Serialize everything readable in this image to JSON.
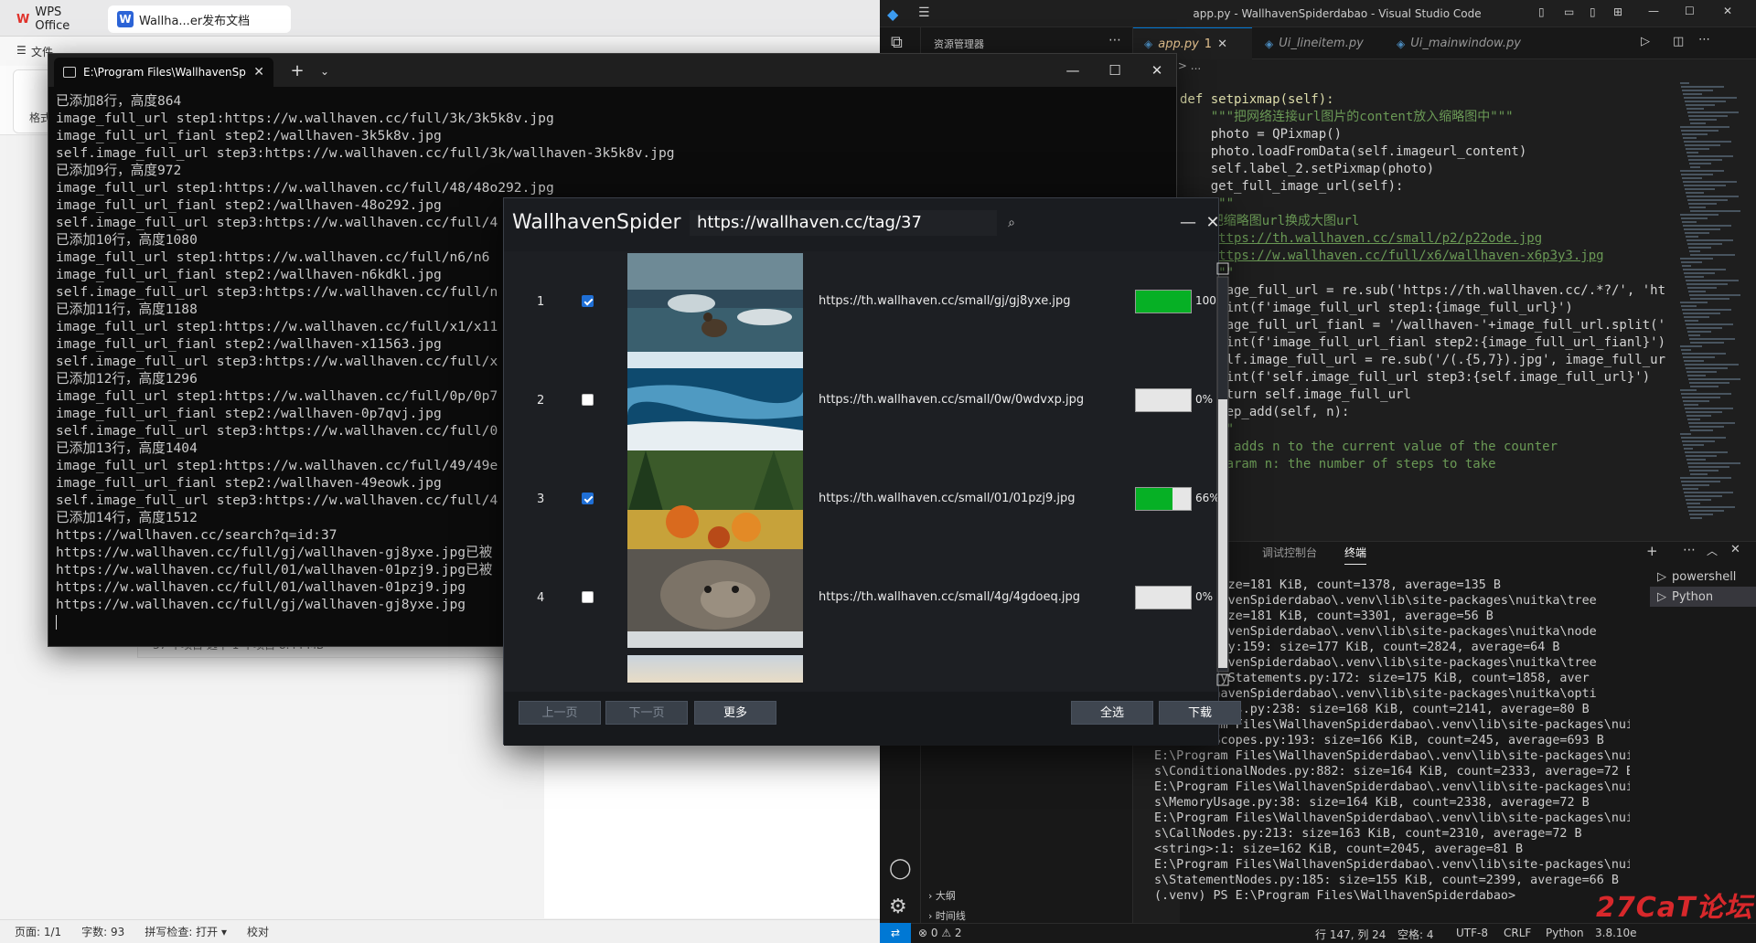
{
  "wps": {
    "tab_office": "WPS Office",
    "tab_doc": "Wallha...er发布文档",
    "menu_file": "文件",
    "format_label": "格式",
    "explorer_status": "37 个项目    选中 1 个项目  8.44 MB",
    "status": [
      "页面: 1/1",
      "字数: 93",
      "拼写检查: 打开 ▾",
      "校对"
    ]
  },
  "terminal": {
    "tab_title": "E:\\Program Files\\WallhavenSp",
    "new_tab": "+",
    "dropdown": "⌄",
    "minimize": "—",
    "maximize": "☐",
    "close": "✕",
    "lines": [
      "已添加8行，高度864",
      "image_full_url step1:https://w.wallhaven.cc/full/3k/3k5k8v.jpg",
      "image_full_url_fianl step2:/wallhaven-3k5k8v.jpg",
      "self.image_full_url step3:https://w.wallhaven.cc/full/3k/wallhaven-3k5k8v.jpg",
      "已添加9行，高度972",
      "image_full_url step1:https://w.wallhaven.cc/full/48/48o292.jpg",
      "image_full_url_fianl step2:/wallhaven-48o292.jpg",
      "self.image_full_url step3:https://w.wallhaven.cc/full/4",
      "已添加10行，高度1080",
      "image_full_url step1:https://w.wallhaven.cc/full/n6/n6",
      "image_full_url_fianl step2:/wallhaven-n6kdkl.jpg",
      "self.image_full_url step3:https://w.wallhaven.cc/full/n",
      "已添加11行，高度1188",
      "image_full_url step1:https://w.wallhaven.cc/full/x1/x11",
      "image_full_url_fianl step2:/wallhaven-x11563.jpg",
      "self.image_full_url step3:https://w.wallhaven.cc/full/x",
      "已添加12行，高度1296",
      "image_full_url step1:https://w.wallhaven.cc/full/0p/0p7",
      "image_full_url_fianl step2:/wallhaven-0p7qvj.jpg",
      "self.image_full_url step3:https://w.wallhaven.cc/full/0",
      "已添加13行，高度1404",
      "image_full_url step1:https://w.wallhaven.cc/full/49/49e",
      "image_full_url_fianl step2:/wallhaven-49eowk.jpg",
      "self.image_full_url step3:https://w.wallhaven.cc/full/4",
      "已添加14行，高度1512",
      "https://wallhaven.cc/search?q=id:37",
      "https://w.wallhaven.cc/full/gj/wallhaven-gj8yxe.jpg已被",
      "https://w.wallhaven.cc/full/01/wallhaven-01pzj9.jpg已被",
      "https://w.wallhaven.cc/full/01/wallhaven-01pzj9.jpg",
      "https://w.wallhaven.cc/full/gj/wallhaven-gj8yxe.jpg"
    ]
  },
  "vscode": {
    "title": "app.py - WallhavenSpiderdabao - Visual Studio Code",
    "explorer_label": "资源管理器",
    "tabs": [
      {
        "label": "app.py",
        "badge": "1"
      },
      {
        "label": "Ui_lineitem.py"
      },
      {
        "label": "Ui_mainwindow.py"
      }
    ],
    "breadcrumb": "app.py > ...",
    "code_lines": [
      "def setpixmap(self):",
      "    \"\"\"把网络连接url图片的content放入缩略图中\"\"\"",
      "    photo = QPixmap()",
      "    photo.loadFromData(self.imageurl_content)",
      "    self.label_2.setPixmap(photo)",
      "",
      "    get_full_image_url(self):",
      "    \"\"\"",
      "    把缩略图url换成大图url",
      "    https://th.wallhaven.cc/small/p2/p22ode.jpg",
      "    https://w.wallhaven.cc/full/x6/wallhaven-x6p3y3.jpg",
      "    \"\"\"",
      "    image_full_url = re.sub('https://th.wallhaven.cc/.*?/', 'ht",
      "    print(f'image_full_url step1:{image_full_url}')",
      "    image_full_url_fianl = '/wallhaven-'+image_full_url.split('",
      "    print(f'image_full_url_fianl step2:{image_full_url_fianl}')",
      "    self.image_full_url = re.sub('/(.{5,7}).jpg', image_full_ur",
      "    print(f'self.image_full_url step3:{self.image_full_url}')",
      "    return self.image_full_url",
      "",
      "    step_add(self, n):",
      "    \"\"\"",
      "    It adds n to the current value of the counter",
      "",
      "    :param n: the number of steps to take"
    ],
    "panel_tabs": [
      "调试控制台",
      "终端"
    ],
    "shells": [
      "powershell",
      "Python"
    ],
    "outline_label": "大纲",
    "timeline_label": "时间线",
    "term_lines": [
      " py:67: size=181 KiB, count=1378, average=135 B",
      " es\\WallhavenSpiderdabao\\.venv\\lib\\site-packages\\nuitka\\tree",
      " y:554: size=181 KiB, count=3301, average=56 B",
      " es\\WallhavenSpiderdabao\\.venv\\lib\\site-packages\\nuitka\\node",
      " ngNodes.py:159: size=177 KiB, count=2824, average=64 B",
      " es\\WallhavenSpiderdabao\\.venv\\lib\\site-packages\\nuitka\\tree",
      " ryFinallyStatements.py:172: size=175 KiB, count=1858, aver",
      "",
      " es\\WallhavenSpiderdabao\\.venv\\lib\\site-packages\\nuitka\\opti",
      " Collections.py:238: size=168 KiB, count=2141, average=80 B",
      "E:\\Program Files\\WallhavenSpiderdabao\\.venv\\lib\\site-packages\\nuitka\\node",
      "s\\LocalsScopes.py:193: size=166 KiB, count=245, average=693 B",
      "E:\\Program Files\\WallhavenSpiderdabao\\.venv\\lib\\site-packages\\nuitka\\node",
      "s\\ConditionalNodes.py:882: size=164 KiB, count=2333, average=72 B",
      "E:\\Program Files\\WallhavenSpiderdabao\\.venv\\lib\\site-packages\\nuitka\\util",
      "s\\MemoryUsage.py:38: size=164 KiB, count=2338, average=72 B",
      "E:\\Program Files\\WallhavenSpiderdabao\\.venv\\lib\\site-packages\\nuitka\\node",
      "s\\CallNodes.py:213: size=163 KiB, count=2310, average=72 B",
      "<string>:1: size=162 KiB, count=2045, average=81 B",
      "E:\\Program Files\\WallhavenSpiderdabao\\.venv\\lib\\site-packages\\nuitka\\node",
      "s\\StatementNodes.py:185: size=155 KiB, count=2399, average=66 B",
      "(.venv) PS E:\\Program Files\\WallhavenSpiderdabao>"
    ],
    "status": {
      "errors": "⊗ 0 ⚠ 2",
      "position": "行 147, 列 24",
      "spaces": "空格: 4",
      "encoding": "UTF-8",
      "eol": "CRLF",
      "language": "Python",
      "version": "3.8.10e"
    }
  },
  "wallhaven": {
    "title": "WallhavenSpider",
    "url_value": "https://wallhaven.cc/tag/37",
    "minimize": "—",
    "close": "✕",
    "rows": [
      {
        "num": "1",
        "checked": true,
        "url": "https://th.wallhaven.cc/small/gj/gj8yxe.jpg",
        "progress": 100,
        "pct": "100%"
      },
      {
        "num": "2",
        "checked": false,
        "url": "https://th.wallhaven.cc/small/0w/0wdvxp.jpg",
        "progress": 0,
        "pct": "0%"
      },
      {
        "num": "3",
        "checked": true,
        "url": "https://th.wallhaven.cc/small/01/01pzj9.jpg",
        "progress": 66,
        "pct": "66%"
      },
      {
        "num": "4",
        "checked": false,
        "url": "https://th.wallhaven.cc/small/4g/4gdoeq.jpg",
        "progress": 0,
        "pct": "0%"
      }
    ],
    "buttons": {
      "prev": "上一页",
      "next": "下一页",
      "more": "更多",
      "select_all": "全选",
      "download": "下载"
    }
  },
  "watermark": "27CaT论坛",
  "colors": {
    "progress_fill": "#06b025",
    "vscode_accent": "#0078d4",
    "checkbox_blue": "#1f6fd6"
  }
}
